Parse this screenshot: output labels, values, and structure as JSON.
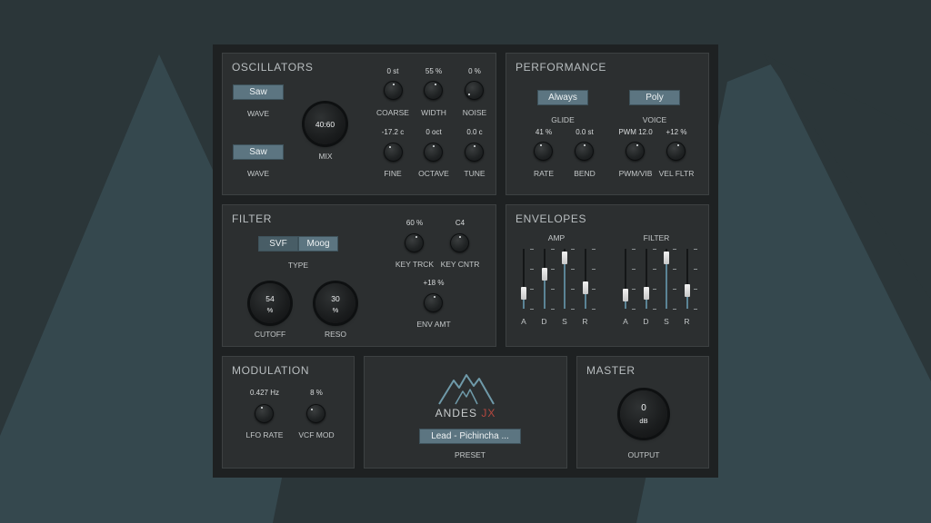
{
  "colors": {
    "accent": "#5c7581",
    "brand_jx": "#b5483f",
    "bg": "#2b3639"
  },
  "oscillators": {
    "title": "OSCILLATORS",
    "wave1": {
      "value": "Saw",
      "label": "WAVE"
    },
    "wave2": {
      "value": "Saw",
      "label": "WAVE"
    },
    "mix": {
      "value": "40:60",
      "label": "MIX"
    },
    "coarse": {
      "value": "0 st",
      "label": "COARSE"
    },
    "width": {
      "value": "55 %",
      "label": "WIDTH"
    },
    "noise": {
      "value": "0 %",
      "label": "NOISE"
    },
    "fine": {
      "value": "-17.2 c",
      "label": "FINE"
    },
    "octave": {
      "value": "0 oct",
      "label": "OCTAVE"
    },
    "tune": {
      "value": "0.0 c",
      "label": "TUNE"
    }
  },
  "performance": {
    "title": "PERFORMANCE",
    "glide": {
      "value": "Always",
      "label": "GLIDE"
    },
    "voice": {
      "value": "Poly",
      "label": "VOICE"
    },
    "rate": {
      "value": "41 %",
      "label": "RATE"
    },
    "bend": {
      "value": "0.0 st",
      "label": "BEND"
    },
    "pwm_vib": {
      "value": "PWM 12.0",
      "label": "PWM/VIB"
    },
    "vel_fltr": {
      "value": "+12 %",
      "label": "VEL FLTR"
    }
  },
  "filter": {
    "title": "FILTER",
    "type_options": [
      "SVF",
      "Moog"
    ],
    "type_selected": "Moog",
    "type_label": "TYPE",
    "cutoff": {
      "value": "54",
      "unit": "%",
      "label": "CUTOFF"
    },
    "reso": {
      "value": "30",
      "unit": "%",
      "label": "RESO"
    },
    "key_trck": {
      "value": "60 %",
      "label": "KEY TRCK"
    },
    "key_cntr": {
      "value": "C4",
      "label": "KEY CNTR"
    },
    "env_amt": {
      "value": "+18 %",
      "label": "ENV AMT"
    }
  },
  "envelopes": {
    "title": "ENVELOPES",
    "amp": {
      "label": "AMP",
      "sliders": [
        {
          "name": "A",
          "level": 0.2
        },
        {
          "name": "D",
          "level": 0.6
        },
        {
          "name": "S",
          "level": 0.95
        },
        {
          "name": "R",
          "level": 0.3
        }
      ]
    },
    "filter": {
      "label": "FILTER",
      "sliders": [
        {
          "name": "A",
          "level": 0.15
        },
        {
          "name": "D",
          "level": 0.2
        },
        {
          "name": "S",
          "level": 0.95
        },
        {
          "name": "R",
          "level": 0.25
        }
      ]
    }
  },
  "modulation": {
    "title": "MODULATION",
    "lfo_rate": {
      "value": "0.427 Hz",
      "label": "LFO RATE"
    },
    "vcf_mod": {
      "value": "8 %",
      "label": "VCF MOD"
    }
  },
  "preset": {
    "brand": "ANDES",
    "brand_suffix": "JX",
    "value": "Lead - Pichincha ...",
    "label": "PRESET"
  },
  "master": {
    "title": "MASTER",
    "output": {
      "value": "0",
      "unit": "dB",
      "label": "OUTPUT"
    }
  }
}
